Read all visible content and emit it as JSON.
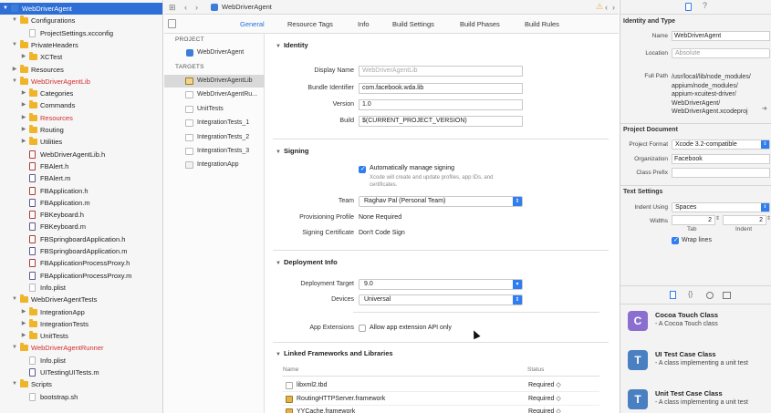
{
  "navigator": {
    "rows": [
      {
        "label": "WebDriverAgent",
        "indent": 0,
        "icon": "project-icon",
        "disclosure": "▼",
        "selected": true,
        "color": ""
      },
      {
        "label": "Configurations",
        "indent": 1,
        "icon": "folder-icon",
        "disclosure": "▼",
        "color": ""
      },
      {
        "label": "ProjectSettings.xcconfig",
        "indent": 2,
        "icon": "doc-icon",
        "disclosure": "",
        "color": ""
      },
      {
        "label": "PrivateHeaders",
        "indent": 1,
        "icon": "folder-icon",
        "disclosure": "▼",
        "color": ""
      },
      {
        "label": "XCTest",
        "indent": 2,
        "icon": "folder-icon",
        "disclosure": "▶",
        "color": ""
      },
      {
        "label": "Resources",
        "indent": 1,
        "icon": "folder-icon",
        "disclosure": "▶",
        "color": ""
      },
      {
        "label": "WebDriverAgentLib",
        "indent": 1,
        "icon": "folder-icon",
        "disclosure": "▼",
        "color": "red"
      },
      {
        "label": "Categories",
        "indent": 2,
        "icon": "folder-icon",
        "disclosure": "▶",
        "color": ""
      },
      {
        "label": "Commands",
        "indent": 2,
        "icon": "folder-icon",
        "disclosure": "▶",
        "color": ""
      },
      {
        "label": "Resources",
        "indent": 2,
        "icon": "folder-icon",
        "disclosure": "▶",
        "color": "red"
      },
      {
        "label": "Routing",
        "indent": 2,
        "icon": "folder-icon",
        "disclosure": "▶",
        "color": ""
      },
      {
        "label": "Utilities",
        "indent": 2,
        "icon": "folder-icon",
        "disclosure": "▶",
        "color": ""
      },
      {
        "label": "WebDriverAgentLib.h",
        "indent": 2,
        "icon": "header-file-icon",
        "disclosure": "",
        "color": ""
      },
      {
        "label": "FBAlert.h",
        "indent": 2,
        "icon": "header-file-icon",
        "disclosure": "",
        "color": ""
      },
      {
        "label": "FBAlert.m",
        "indent": 2,
        "icon": "source-file-icon",
        "disclosure": "",
        "color": ""
      },
      {
        "label": "FBApplication.h",
        "indent": 2,
        "icon": "header-file-icon",
        "disclosure": "",
        "color": ""
      },
      {
        "label": "FBApplication.m",
        "indent": 2,
        "icon": "source-file-icon",
        "disclosure": "",
        "color": ""
      },
      {
        "label": "FBKeyboard.h",
        "indent": 2,
        "icon": "header-file-icon",
        "disclosure": "",
        "color": ""
      },
      {
        "label": "FBKeyboard.m",
        "indent": 2,
        "icon": "source-file-icon",
        "disclosure": "",
        "color": ""
      },
      {
        "label": "FBSpringboardApplication.h",
        "indent": 2,
        "icon": "header-file-icon",
        "disclosure": "",
        "color": ""
      },
      {
        "label": "FBSpringboardApplication.m",
        "indent": 2,
        "icon": "source-file-icon",
        "disclosure": "",
        "color": ""
      },
      {
        "label": "FBApplicationProcessProxy.h",
        "indent": 2,
        "icon": "header-file-icon",
        "disclosure": "",
        "color": ""
      },
      {
        "label": "FBApplicationProcessProxy.m",
        "indent": 2,
        "icon": "source-file-icon",
        "disclosure": "",
        "color": ""
      },
      {
        "label": "Info.plist",
        "indent": 2,
        "icon": "doc-icon",
        "disclosure": "",
        "color": ""
      },
      {
        "label": "WebDriverAgentTests",
        "indent": 1,
        "icon": "folder-icon",
        "disclosure": "▼",
        "color": ""
      },
      {
        "label": "IntegrationApp",
        "indent": 2,
        "icon": "folder-icon",
        "disclosure": "▶",
        "color": ""
      },
      {
        "label": "IntegrationTests",
        "indent": 2,
        "icon": "folder-icon",
        "disclosure": "▶",
        "color": ""
      },
      {
        "label": "UnitTests",
        "indent": 2,
        "icon": "folder-icon",
        "disclosure": "▶",
        "color": ""
      },
      {
        "label": "WebDriverAgentRunner",
        "indent": 1,
        "icon": "folder-icon",
        "disclosure": "▼",
        "color": "red"
      },
      {
        "label": "Info.plist",
        "indent": 2,
        "icon": "doc-icon",
        "disclosure": "",
        "color": ""
      },
      {
        "label": "UITestingUITests.m",
        "indent": 2,
        "icon": "source-file-icon",
        "disclosure": "",
        "color": ""
      },
      {
        "label": "Scripts",
        "indent": 1,
        "icon": "folder-icon",
        "disclosure": "▼",
        "color": ""
      },
      {
        "label": "bootstrap.sh",
        "indent": 2,
        "icon": "doc-icon",
        "disclosure": "",
        "color": ""
      }
    ]
  },
  "editor": {
    "breadcrumb": "WebDriverAgent",
    "tabs": [
      "General",
      "Resource Tags",
      "Info",
      "Build Settings",
      "Build Phases",
      "Build Rules"
    ]
  },
  "targets": {
    "project_header": "PROJECT",
    "project_item": "WebDriverAgent",
    "targets_header": "TARGETS",
    "items": [
      {
        "label": "WebDriverAgentLib",
        "icon": "lib",
        "selected": true
      },
      {
        "label": "WebDriverAgentRu...",
        "icon": "test",
        "selected": false
      },
      {
        "label": "UnitTests",
        "icon": "test",
        "selected": false
      },
      {
        "label": "IntegrationTests_1",
        "icon": "test",
        "selected": false
      },
      {
        "label": "IntegrationTests_2",
        "icon": "test",
        "selected": false
      },
      {
        "label": "IntegrationTests_3",
        "icon": "test",
        "selected": false
      },
      {
        "label": "IntegrationApp",
        "icon": "app",
        "selected": false
      }
    ]
  },
  "identity": {
    "title": "Identity",
    "display_name_label": "Display Name",
    "display_name_placeholder": "WebDriverAgentLib",
    "bundle_id_label": "Bundle Identifier",
    "bundle_id": "com.facebook.wda.lib",
    "version_label": "Version",
    "version": "1.0",
    "build_label": "Build",
    "build": "$(CURRENT_PROJECT_VERSION)"
  },
  "signing": {
    "title": "Signing",
    "auto_label": "Automatically manage signing",
    "auto_checked": true,
    "auto_desc": "Xcode will create and update profiles, app IDs, and certificates.",
    "team_label": "Team",
    "team": "Raghav Pal (Personal Team)",
    "profile_label": "Provisioning Profile",
    "profile": "None Required",
    "cert_label": "Signing Certificate",
    "cert": "Don't Code Sign"
  },
  "deployment": {
    "title": "Deployment Info",
    "target_label": "Deployment Target",
    "target": "9.0",
    "devices_label": "Devices",
    "devices": "Universal",
    "extensions_label": "App Extensions",
    "extensions_option": "Allow app extension API only"
  },
  "frameworks": {
    "title": "Linked Frameworks and Libraries",
    "col_name": "Name",
    "col_status": "Status",
    "rows": [
      {
        "name": "libxml2.tbd",
        "status": "Required ◇",
        "icon": "doc"
      },
      {
        "name": "RoutingHTTPServer.framework",
        "status": "Required ◇",
        "icon": "framework"
      },
      {
        "name": "YYCache.framework",
        "status": "Required ◇",
        "icon": "framework"
      }
    ]
  },
  "inspector": {
    "identity_title": "Identity and Type",
    "name_label": "Name",
    "name": "WebDriverAgent",
    "location_label": "Location",
    "location": "Absolute",
    "fullpath_label": "Full Path",
    "fullpath_lines": [
      "/usr/local/lib/node_modules/",
      "appium/node_modules/",
      "appium-xcuitest-driver/",
      "WebDriverAgent/",
      "WebDriverAgent.xcodeproj"
    ],
    "project_doc_title": "Project Document",
    "format_label": "Project Format",
    "format": "Xcode 3.2-compatible",
    "org_label": "Organization",
    "org": "Facebook",
    "prefix_label": "Class Prefix",
    "prefix": "",
    "text_settings_title": "Text Settings",
    "indent_using_label": "Indent Using",
    "indent_using": "Spaces",
    "widths_label": "Widths",
    "tab_width": "2",
    "indent_width": "2",
    "tab_caption": "Tab",
    "indent_caption": "Indent",
    "wrap_label": "Wrap lines",
    "wrap_checked": true,
    "library": [
      {
        "title": "Cocoa Touch Class",
        "desc": " - A Cocoa Touch class",
        "letter": "C",
        "color": "#8a6fd1"
      },
      {
        "title": "UI Test Case Class",
        "desc": " - A class implementing a unit test",
        "letter": "T",
        "color": "#4a7fc1"
      },
      {
        "title": "Unit Test Case Class",
        "desc": " - A class implementing a unit test",
        "letter": "T",
        "color": "#4a7fc1"
      }
    ]
  },
  "colors": {
    "accent": "#2f7df0",
    "selection": "#2d6fd6",
    "warning": "#e8b33a"
  }
}
